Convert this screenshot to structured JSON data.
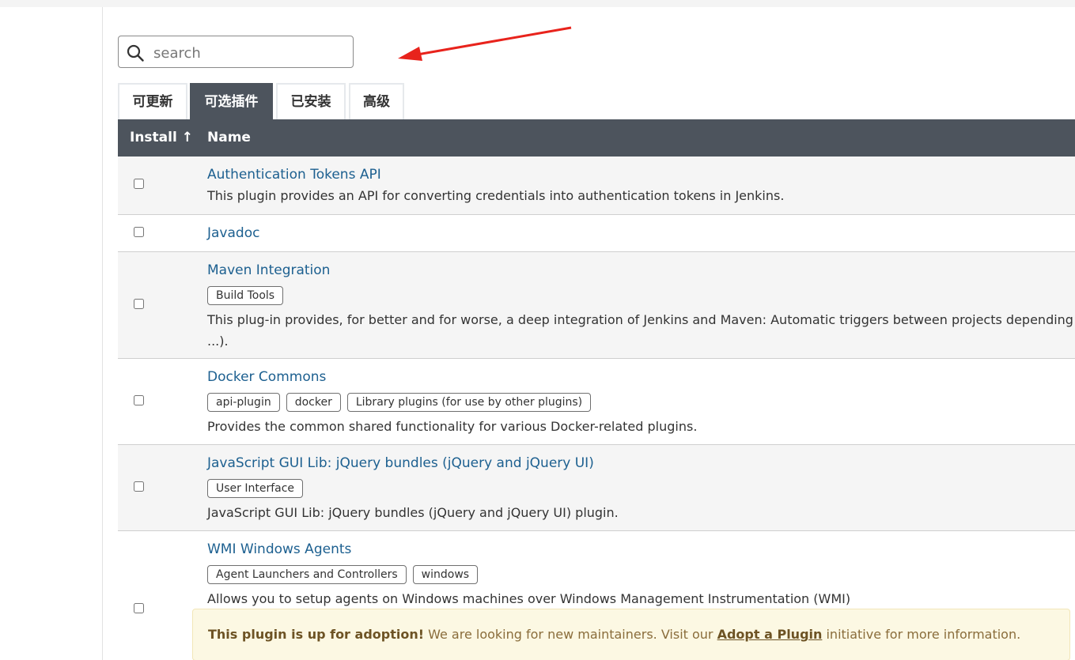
{
  "search": {
    "placeholder": "search",
    "value": ""
  },
  "tabs": [
    {
      "label": "可更新",
      "active": false
    },
    {
      "label": "可选插件",
      "active": true
    },
    {
      "label": "已安装",
      "active": false
    },
    {
      "label": "高级",
      "active": false
    }
  ],
  "table": {
    "columns": {
      "install": "Install ↑",
      "name": "Name"
    },
    "rows": [
      {
        "name": "Authentication Tokens API",
        "tags": [],
        "description": "This plugin provides an API for converting credentials into authentication tokens in Jenkins.",
        "checked": false
      },
      {
        "name": "Javadoc",
        "tags": [],
        "description": "",
        "checked": false
      },
      {
        "name": "Maven Integration",
        "tags": [
          "Build Tools"
        ],
        "description": "This plug-in provides, for better and for worse, a deep integration of Jenkins and Maven: Automatic triggers between projects depending on SI",
        "description_cont": "...).",
        "checked": false
      },
      {
        "name": "Docker Commons",
        "tags": [
          "api-plugin",
          "docker",
          "Library plugins (for use by other plugins)"
        ],
        "description": "Provides the common shared functionality for various Docker-related plugins.",
        "checked": false
      },
      {
        "name": "JavaScript GUI Lib: jQuery bundles (jQuery and jQuery UI)",
        "tags": [
          "User Interface"
        ],
        "description": "JavaScript GUI Lib: jQuery bundles (jQuery and jQuery UI) plugin.",
        "checked": false
      },
      {
        "name": "WMI Windows Agents",
        "tags": [
          "Agent Launchers and Controllers",
          "windows"
        ],
        "description": "Allows you to setup agents on Windows machines over Windows Management Instrumentation (WMI)",
        "checked": false
      }
    ]
  },
  "adoption": {
    "strong": "This plugin is up for adoption!",
    "text": " We are looking for new maintainers. Visit our ",
    "link": "Adopt a Plugin",
    "after": " initiative for more information."
  },
  "colors": {
    "header_bg": "#4d545d",
    "link": "#1d6090",
    "arrow": "#e8231c",
    "adopt_bg": "#fcf8e3"
  }
}
